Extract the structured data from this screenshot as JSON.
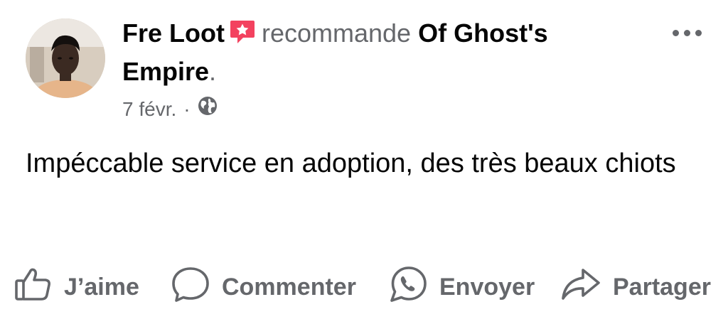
{
  "post": {
    "author": "Fre Loot",
    "verb": "recommande",
    "page_line1": "Of Ghost's",
    "page_line2": "Empire",
    "period": ".",
    "date": "7 févr.",
    "separator": "·",
    "text": "Impéccable service en adoption, des très beaux chiots",
    "icons": {
      "recommend": "recommend-star-icon",
      "privacy": "globe-icon",
      "more": "more-options-icon"
    }
  },
  "actions": {
    "like": {
      "label": "J’aime",
      "icon": "thumbs-up-icon"
    },
    "comment": {
      "label": "Commenter",
      "icon": "comment-icon"
    },
    "send": {
      "label": "Envoyer",
      "icon": "whatsapp-icon"
    },
    "share": {
      "label": "Partager",
      "icon": "share-icon"
    }
  },
  "colors": {
    "primary_text": "#050505",
    "secondary_text": "#65676b",
    "recommend_badge": "#f3425f"
  }
}
